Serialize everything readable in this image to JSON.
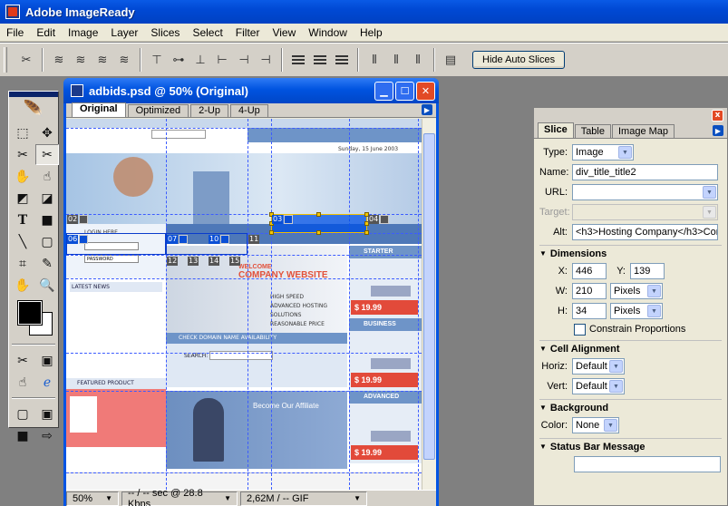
{
  "app": {
    "title": "Adobe ImageReady"
  },
  "menu": [
    "File",
    "Edit",
    "Image",
    "Layer",
    "Slices",
    "Select",
    "Filter",
    "View",
    "Window",
    "Help"
  ],
  "options_bar": {
    "hide_auto_slices": "Hide Auto Slices"
  },
  "document": {
    "title": "adbids.psd @ 50% (Original)",
    "tabs": [
      "Original",
      "Optimized",
      "2-Up",
      "4-Up"
    ],
    "active_tab": "Original",
    "status": {
      "zoom": "50%",
      "download": "-- / -- sec @ 28.8 Kbps",
      "size": "2,62M / -- GIF"
    }
  },
  "canvas": {
    "company_title_1": "WELCOME",
    "company_title_2": "COMPANY WEBSITE",
    "bullets": [
      "HIGH SPEED",
      "ADVANCED HOSTING SOLUTIONS",
      "REASONABLE PRICE"
    ],
    "plans": [
      {
        "name": "STARTER",
        "price": "$ 19.99"
      },
      {
        "name": "BUSINESS",
        "price": "$ 19.99"
      },
      {
        "name": "ADVANCED",
        "price": "$ 19.99"
      }
    ],
    "domain_bar": "CHECK DOMAIN NAME AVAILABILITY",
    "search_label": "SEARCH:",
    "news_head": "LATEST NEWS",
    "featured_head": "FEATURED PRODUCT",
    "affiliate_title": "Become Our Affiliate",
    "date": "Sunday, 15 June 2003",
    "login_label": "LOGIN HERE",
    "password_label": "PASSWORD",
    "slices": {
      "s02": "02",
      "s03": "03",
      "s04": "04",
      "s06": "06",
      "s07": "07",
      "s10": "10",
      "s11": "11",
      "s12": "12",
      "s13": "13",
      "s14": "14",
      "s15": "15"
    }
  },
  "slice_palette": {
    "close": "x",
    "tabs": [
      "Slice",
      "Table",
      "Image Map"
    ],
    "active_tab": "Slice",
    "type_label": "Type:",
    "type": "Image",
    "name_label": "Name:",
    "name": "div_title_title2",
    "url_label": "URL:",
    "url": "",
    "target_label": "Target:",
    "target": "",
    "alt_label": "Alt:",
    "alt": "<h3>Hosting Company</h3>Cor",
    "dimensions": {
      "header": "Dimensions",
      "x_label": "X:",
      "x": "446",
      "y_label": "Y:",
      "y": "139",
      "w_label": "W:",
      "w": "210",
      "w_unit": "Pixels",
      "h_label": "H:",
      "h": "34",
      "h_unit": "Pixels",
      "constrain": "Constrain Proportions"
    },
    "cell_alignment": {
      "header": "Cell Alignment",
      "horiz_label": "Horiz:",
      "horiz": "Default",
      "vert_label": "Vert:",
      "vert": "Default"
    },
    "background": {
      "header": "Background",
      "color_label": "Color:",
      "color": "None"
    },
    "status_bar": {
      "header": "Status Bar Message",
      "value": ""
    }
  },
  "colors": {
    "accent": "#0054e3",
    "slice_line": "#3c5cff",
    "selected_slice": "#0050e6",
    "handle": "#f5c800"
  }
}
